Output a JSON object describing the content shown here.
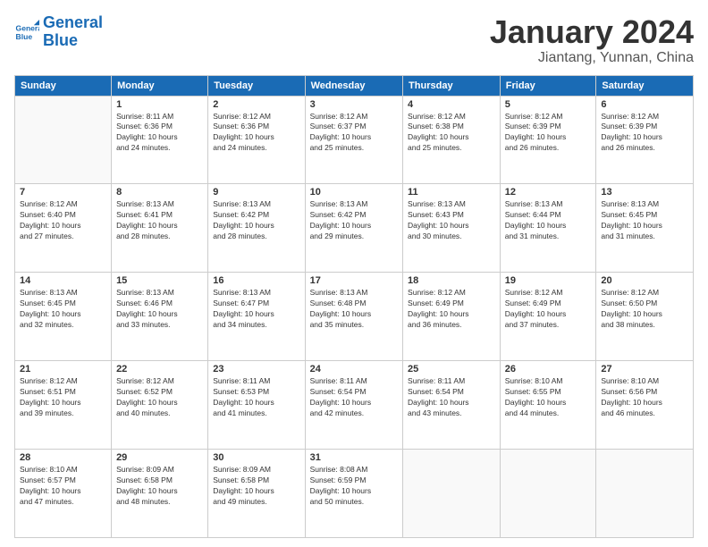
{
  "logo": {
    "line1": "General",
    "line2": "Blue"
  },
  "header": {
    "month": "January 2024",
    "location": "Jiantang, Yunnan, China"
  },
  "days_of_week": [
    "Sunday",
    "Monday",
    "Tuesday",
    "Wednesday",
    "Thursday",
    "Friday",
    "Saturday"
  ],
  "weeks": [
    [
      {
        "day": "",
        "info": ""
      },
      {
        "day": "1",
        "info": "Sunrise: 8:11 AM\nSunset: 6:36 PM\nDaylight: 10 hours\nand 24 minutes."
      },
      {
        "day": "2",
        "info": "Sunrise: 8:12 AM\nSunset: 6:36 PM\nDaylight: 10 hours\nand 24 minutes."
      },
      {
        "day": "3",
        "info": "Sunrise: 8:12 AM\nSunset: 6:37 PM\nDaylight: 10 hours\nand 25 minutes."
      },
      {
        "day": "4",
        "info": "Sunrise: 8:12 AM\nSunset: 6:38 PM\nDaylight: 10 hours\nand 25 minutes."
      },
      {
        "day": "5",
        "info": "Sunrise: 8:12 AM\nSunset: 6:39 PM\nDaylight: 10 hours\nand 26 minutes."
      },
      {
        "day": "6",
        "info": "Sunrise: 8:12 AM\nSunset: 6:39 PM\nDaylight: 10 hours\nand 26 minutes."
      }
    ],
    [
      {
        "day": "7",
        "info": "Sunrise: 8:12 AM\nSunset: 6:40 PM\nDaylight: 10 hours\nand 27 minutes."
      },
      {
        "day": "8",
        "info": "Sunrise: 8:13 AM\nSunset: 6:41 PM\nDaylight: 10 hours\nand 28 minutes."
      },
      {
        "day": "9",
        "info": "Sunrise: 8:13 AM\nSunset: 6:42 PM\nDaylight: 10 hours\nand 28 minutes."
      },
      {
        "day": "10",
        "info": "Sunrise: 8:13 AM\nSunset: 6:42 PM\nDaylight: 10 hours\nand 29 minutes."
      },
      {
        "day": "11",
        "info": "Sunrise: 8:13 AM\nSunset: 6:43 PM\nDaylight: 10 hours\nand 30 minutes."
      },
      {
        "day": "12",
        "info": "Sunrise: 8:13 AM\nSunset: 6:44 PM\nDaylight: 10 hours\nand 31 minutes."
      },
      {
        "day": "13",
        "info": "Sunrise: 8:13 AM\nSunset: 6:45 PM\nDaylight: 10 hours\nand 31 minutes."
      }
    ],
    [
      {
        "day": "14",
        "info": "Sunrise: 8:13 AM\nSunset: 6:45 PM\nDaylight: 10 hours\nand 32 minutes."
      },
      {
        "day": "15",
        "info": "Sunrise: 8:13 AM\nSunset: 6:46 PM\nDaylight: 10 hours\nand 33 minutes."
      },
      {
        "day": "16",
        "info": "Sunrise: 8:13 AM\nSunset: 6:47 PM\nDaylight: 10 hours\nand 34 minutes."
      },
      {
        "day": "17",
        "info": "Sunrise: 8:13 AM\nSunset: 6:48 PM\nDaylight: 10 hours\nand 35 minutes."
      },
      {
        "day": "18",
        "info": "Sunrise: 8:12 AM\nSunset: 6:49 PM\nDaylight: 10 hours\nand 36 minutes."
      },
      {
        "day": "19",
        "info": "Sunrise: 8:12 AM\nSunset: 6:49 PM\nDaylight: 10 hours\nand 37 minutes."
      },
      {
        "day": "20",
        "info": "Sunrise: 8:12 AM\nSunset: 6:50 PM\nDaylight: 10 hours\nand 38 minutes."
      }
    ],
    [
      {
        "day": "21",
        "info": "Sunrise: 8:12 AM\nSunset: 6:51 PM\nDaylight: 10 hours\nand 39 minutes."
      },
      {
        "day": "22",
        "info": "Sunrise: 8:12 AM\nSunset: 6:52 PM\nDaylight: 10 hours\nand 40 minutes."
      },
      {
        "day": "23",
        "info": "Sunrise: 8:11 AM\nSunset: 6:53 PM\nDaylight: 10 hours\nand 41 minutes."
      },
      {
        "day": "24",
        "info": "Sunrise: 8:11 AM\nSunset: 6:54 PM\nDaylight: 10 hours\nand 42 minutes."
      },
      {
        "day": "25",
        "info": "Sunrise: 8:11 AM\nSunset: 6:54 PM\nDaylight: 10 hours\nand 43 minutes."
      },
      {
        "day": "26",
        "info": "Sunrise: 8:10 AM\nSunset: 6:55 PM\nDaylight: 10 hours\nand 44 minutes."
      },
      {
        "day": "27",
        "info": "Sunrise: 8:10 AM\nSunset: 6:56 PM\nDaylight: 10 hours\nand 46 minutes."
      }
    ],
    [
      {
        "day": "28",
        "info": "Sunrise: 8:10 AM\nSunset: 6:57 PM\nDaylight: 10 hours\nand 47 minutes."
      },
      {
        "day": "29",
        "info": "Sunrise: 8:09 AM\nSunset: 6:58 PM\nDaylight: 10 hours\nand 48 minutes."
      },
      {
        "day": "30",
        "info": "Sunrise: 8:09 AM\nSunset: 6:58 PM\nDaylight: 10 hours\nand 49 minutes."
      },
      {
        "day": "31",
        "info": "Sunrise: 8:08 AM\nSunset: 6:59 PM\nDaylight: 10 hours\nand 50 minutes."
      },
      {
        "day": "",
        "info": ""
      },
      {
        "day": "",
        "info": ""
      },
      {
        "day": "",
        "info": ""
      }
    ]
  ]
}
